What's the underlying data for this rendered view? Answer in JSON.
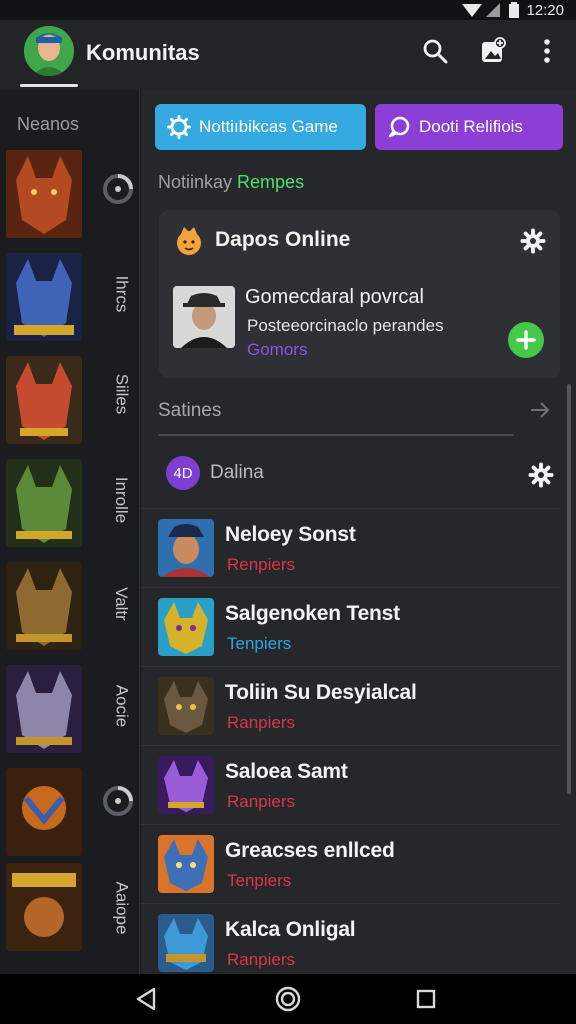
{
  "status_bar": {
    "time": "12:20"
  },
  "app_bar": {
    "title": "Komunitas"
  },
  "left_rail": {
    "title": "Neanos",
    "labels": [
      "Ihrcs",
      "Siiles",
      "Inrolle",
      "Valtr",
      "Aocie",
      "Aaiope"
    ],
    "thumb_colors": [
      "#a3421f",
      "#3a57a6",
      "#b8482c",
      "#4f7a33",
      "#8a5c2a",
      "#5f4a8f",
      "#b06a1f",
      "#b57a2a"
    ]
  },
  "top_buttons": {
    "left": {
      "label": "Nottiıbikcas Game",
      "icon": "gear-icon",
      "color": "#35a9e2"
    },
    "right": {
      "label": "Dooti Relifiois",
      "icon": "chat-icon",
      "color": "#8b3fd6"
    }
  },
  "subheading": {
    "prefix": "Notiinkay",
    "accent": "Rempes",
    "accent_color": "#4ee06a"
  },
  "featured_card": {
    "title": "Dapos Online",
    "line1": "Gomecdaral povrcal",
    "line2": "Posteeorcinaclo perandes",
    "line3": "Gomors",
    "line3_color": "#8b52e6",
    "add_color": "#45c948"
  },
  "section": {
    "label": "Satines"
  },
  "server": {
    "name": "Dalina",
    "icon_text": "4D"
  },
  "list": [
    {
      "name": "Neloey Sonst",
      "sub": "Renpiers",
      "sub_color": "#d9364a",
      "thumb_color": "#2f6fb0"
    },
    {
      "name": "Salgenoken Tenst",
      "sub": "Tenpiers",
      "sub_color": "#2ea3e3",
      "thumb_color": "#d6b22a"
    },
    {
      "name": "Toliin Su Desyialcal",
      "sub": "Ranpiers",
      "sub_color": "#d9364a",
      "thumb_color": "#6a5840"
    },
    {
      "name": "Saloea Samt",
      "sub": "Ranpiers",
      "sub_color": "#d9364a",
      "thumb_color": "#6b38b8"
    },
    {
      "name": "Greacses enllced",
      "sub": "Tenpiers",
      "sub_color": "#d9364a",
      "thumb_color": "#d9742a"
    },
    {
      "name": "Kalca Onligal",
      "sub": "Ranpiers",
      "sub_color": "#d9364a",
      "thumb_color": "#3d7ab8"
    }
  ]
}
